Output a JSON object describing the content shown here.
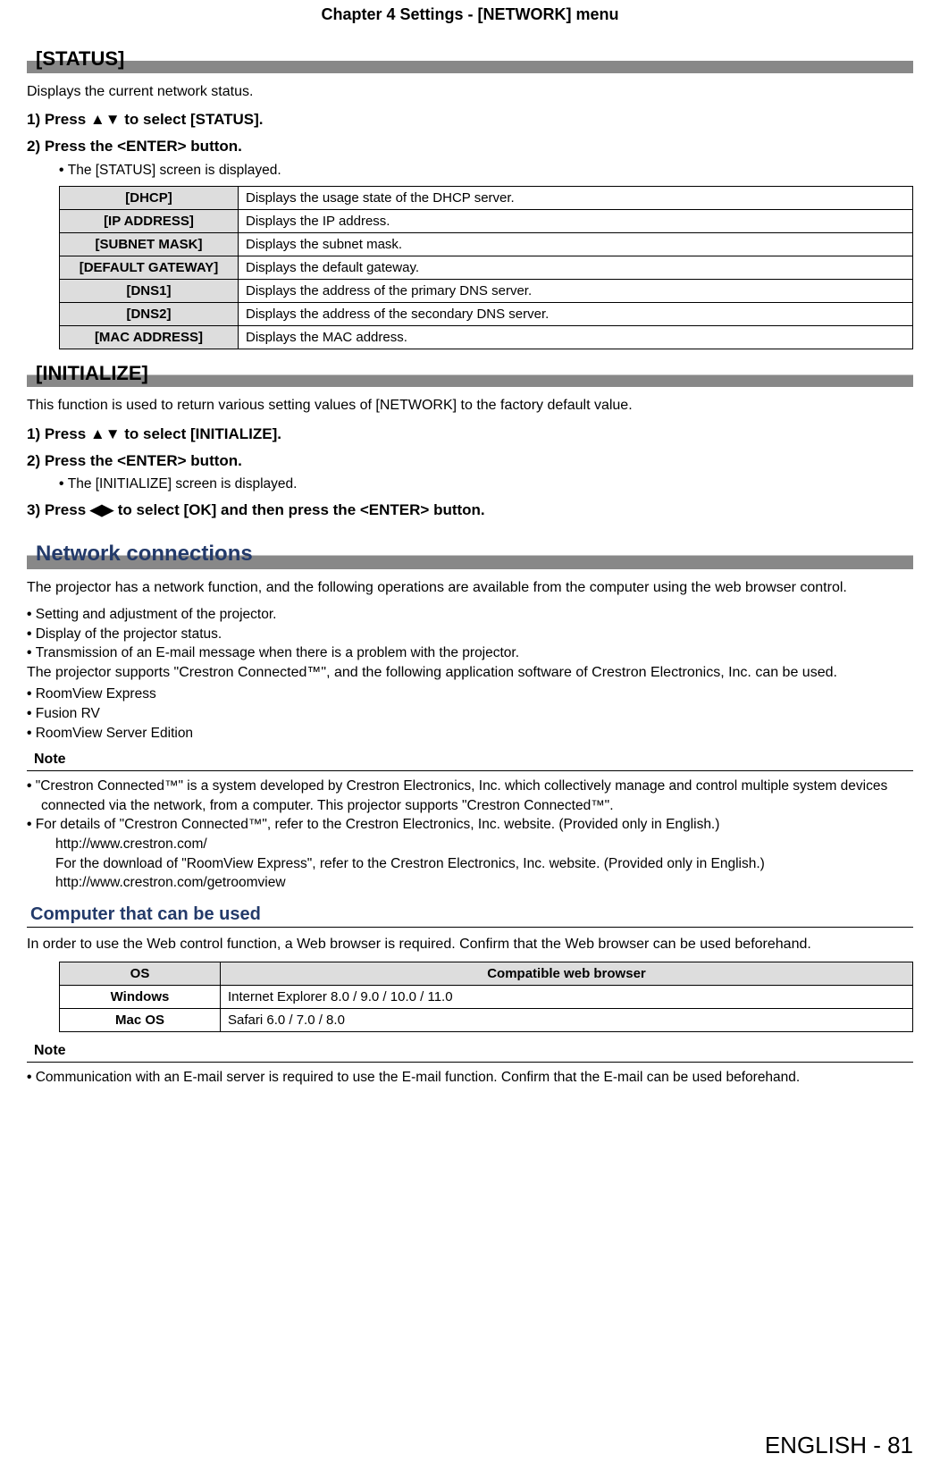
{
  "header": {
    "chapter": "Chapter 4   Settings - [NETWORK] menu"
  },
  "status_section": {
    "title": "[STATUS]",
    "intro": "Displays the current network status.",
    "step1_prefix": "1)    Press ",
    "step1_suffix": " to select [STATUS].",
    "step2": "2)    Press the <ENTER> button.",
    "step2_bullet": "The [STATUS] screen is displayed.",
    "table": [
      {
        "k": "[DHCP]",
        "v": "Displays the usage state of the DHCP server."
      },
      {
        "k": "[IP ADDRESS]",
        "v": "Displays the IP address."
      },
      {
        "k": "[SUBNET MASK]",
        "v": "Displays the subnet mask."
      },
      {
        "k": "[DEFAULT GATEWAY]",
        "v": "Displays the default gateway."
      },
      {
        "k": "[DNS1]",
        "v": "Displays the address of the primary DNS server."
      },
      {
        "k": "[DNS2]",
        "v": "Displays the address of the secondary DNS server."
      },
      {
        "k": "[MAC ADDRESS]",
        "v": "Displays the MAC address."
      }
    ]
  },
  "init_section": {
    "title": "[INITIALIZE]",
    "intro": "This function is used to return various setting values of [NETWORK] to the factory default value.",
    "step1_prefix": "1)    Press ",
    "step1_suffix": " to select [INITIALIZE].",
    "step2": "2)    Press the <ENTER> button.",
    "step2_bullet": "The [INITIALIZE] screen is displayed.",
    "step3_prefix": "3)    Press ",
    "step3_suffix": " to select [OK] and then press the <ENTER> button."
  },
  "network_section": {
    "title": "Network connections",
    "p1": "The projector has a network function, and the following operations are available from the computer using the web browser control.",
    "bullets1": [
      "Setting and adjustment of the projector.",
      "Display of the projector status.",
      "Transmission of an E-mail message when there is a problem with the projector."
    ],
    "p2": "The projector supports \"Crestron Connected™\", and the following application software of Crestron Electronics, Inc. can be used.",
    "bullets2": [
      "RoomView Express",
      "Fusion RV",
      "RoomView Server Edition"
    ],
    "note_heading": "Note",
    "note_items": [
      {
        "line1": "\"Crestron Connected™\" is a system developed by Crestron Electronics, Inc. which collectively manage and control multiple system devices connected via the network, from a computer. This projector supports \"Crestron Connected™\"."
      },
      {
        "line1": "For details of \"Crestron Connected™\", refer to the Crestron Electronics, Inc. website. (Provided only in English.)",
        "line2": "http://www.crestron.com/",
        "line3": "For the download of \"RoomView Express\", refer to the Crestron Electronics, Inc. website. (Provided only in English.)",
        "line4": "http://www.crestron.com/getroomview"
      }
    ]
  },
  "computer_section": {
    "title": "Computer that can be used",
    "intro": "In order to use the Web control function, a Web browser is required. Confirm that the Web browser can be used beforehand.",
    "th_os": "OS",
    "th_browser": "Compatible web browser",
    "rows": [
      {
        "os": "Windows",
        "browser": "Internet Explorer 8.0 / 9.0 / 10.0 / 11.0"
      },
      {
        "os": "Mac OS",
        "browser": "Safari 6.0 / 7.0 / 8.0"
      }
    ],
    "note_heading": "Note",
    "note_item": "Communication with an E-mail server is required to use the E-mail function. Confirm that the E-mail can be used beforehand."
  },
  "footer": {
    "lang": "ENGLISH - 81"
  }
}
